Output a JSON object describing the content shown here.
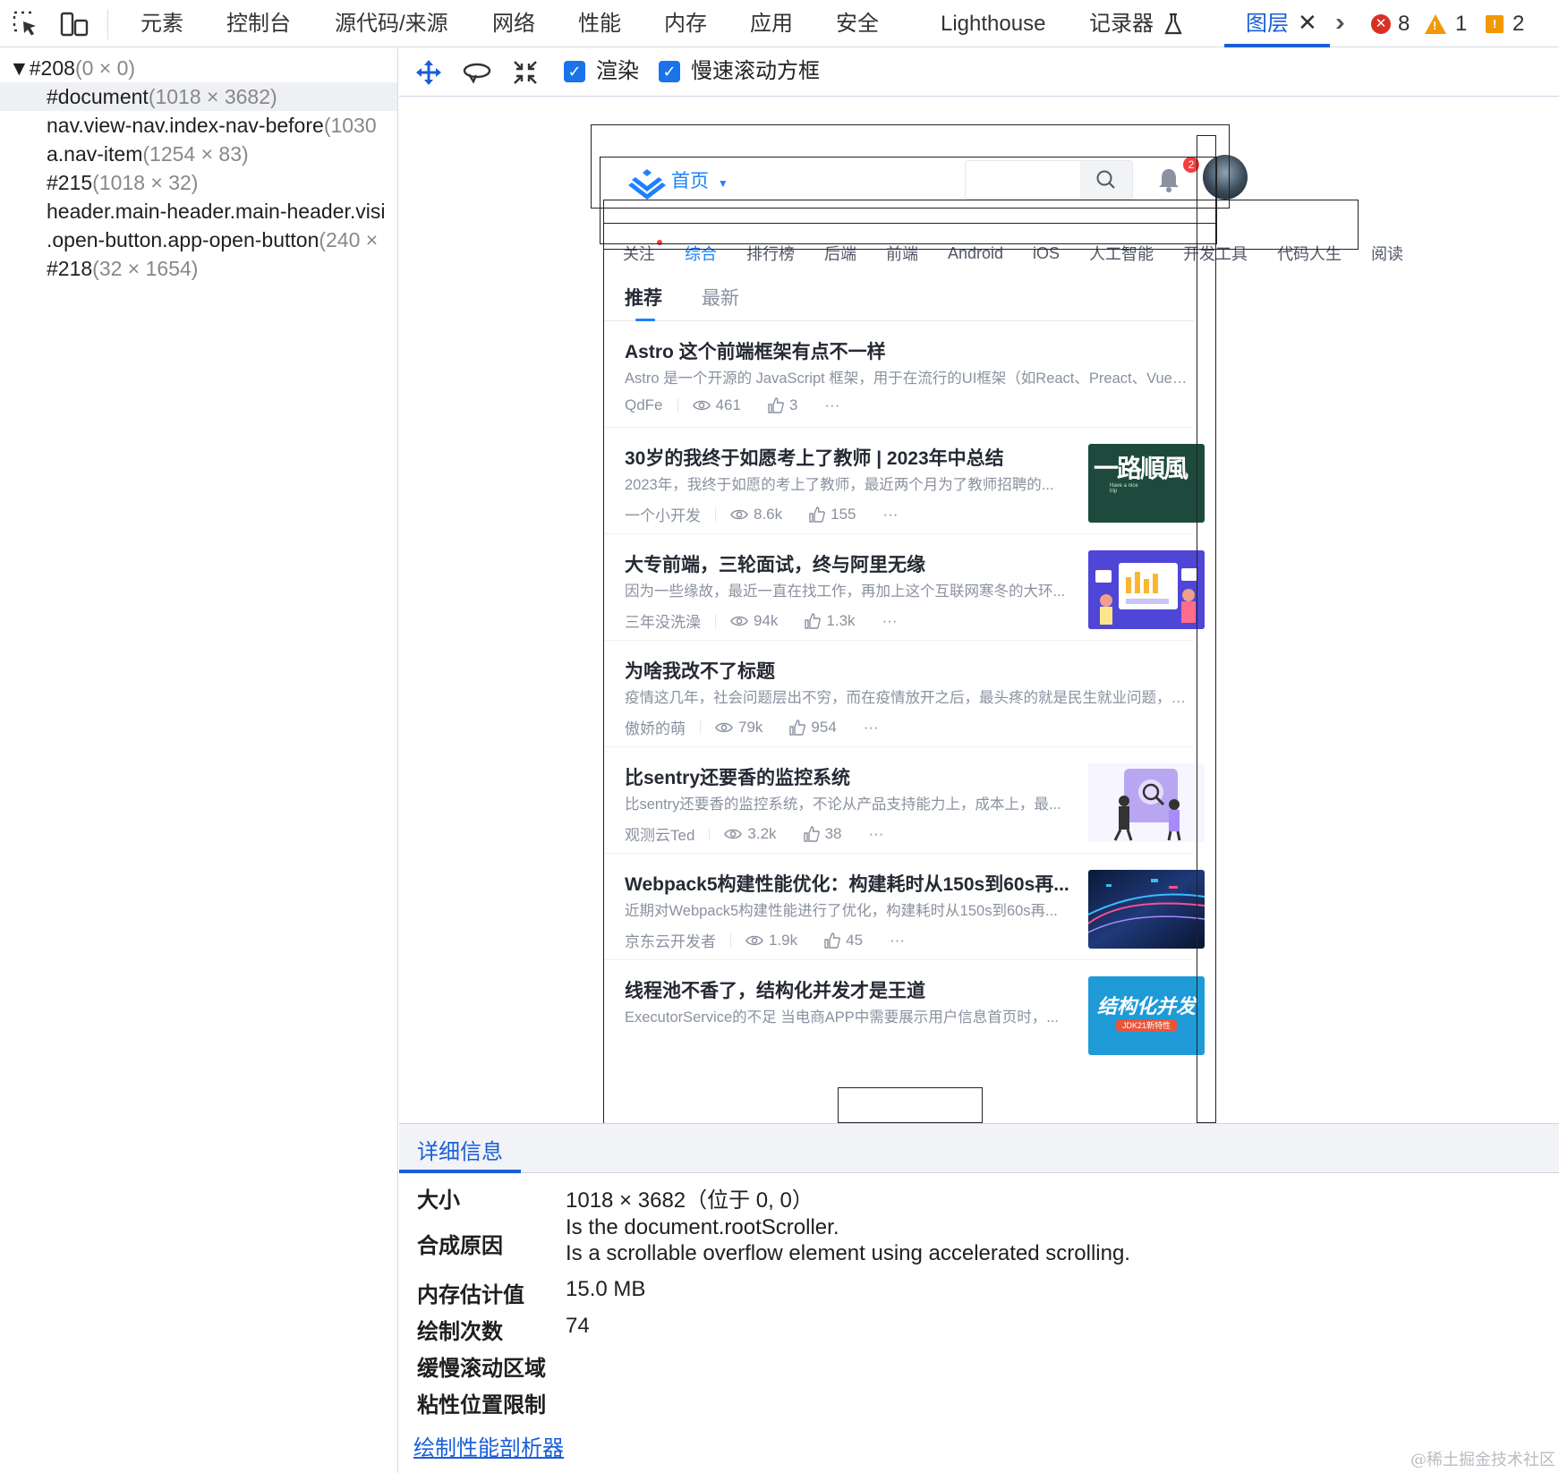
{
  "topbar": {
    "tabs": [
      "元素",
      "控制台",
      "源代码/来源",
      "网络",
      "性能",
      "内存",
      "应用",
      "安全",
      "Lighthouse",
      "记录器",
      "图层"
    ],
    "active_tab": "图层",
    "errors": "8",
    "warnings": "1",
    "issues": "2",
    "icons": [
      "inspect-element-icon",
      "device-toolbar-icon",
      "flask-icon",
      "close-icon",
      "more-tabs-icon"
    ]
  },
  "tree": {
    "items": [
      {
        "name": "▼#208",
        "dim": "(0 × 0)"
      },
      {
        "name": "#document",
        "dim": "(1018 × 3682)"
      },
      {
        "name": "nav.view-nav.index-nav-before",
        "dim": "(1030"
      },
      {
        "name": "a.nav-item",
        "dim": "(1254 × 83)"
      },
      {
        "name": "#215",
        "dim": "(1018 × 32)"
      },
      {
        "name": "header.main-header.main-header.visi",
        "dim": ""
      },
      {
        "name": ".open-button.app-open-button",
        "dim": "(240 ×"
      },
      {
        "name": "#218",
        "dim": "(32 × 1654)"
      }
    ]
  },
  "layer_toolbar": {
    "render_label": "渲染",
    "slow_scroll_label": "慢速滚动方框",
    "render_checked": true,
    "slow_scroll_checked": true
  },
  "preview": {
    "home_label": "首页",
    "bell_count": "2",
    "categories": [
      "关注",
      "综合",
      "排行榜",
      "后端",
      "前端",
      "Android",
      "iOS",
      "人工智能",
      "开发工具",
      "代码人生",
      "阅读"
    ],
    "active_category": "综合",
    "feed_tabs": [
      "推荐",
      "最新"
    ],
    "articles": [
      {
        "title": "Astro 这个前端框架有点不一样",
        "desc": "Astro 是一个开源的 JavaScript 框架，用于在流行的UI框架（如React、Preact、Vue 或...",
        "author": "QdFe",
        "views": "461",
        "likes": "3",
        "thumb": ""
      },
      {
        "title": "30岁的我终于如愿考上了教师 | 2023年中总结",
        "desc": "2023年，我终于如愿的考上了教师，最近两个月为了教师招聘的...",
        "author": "一个小开发",
        "views": "8.6k",
        "likes": "155",
        "thumb": "calligraphy"
      },
      {
        "title": "大专前端，三轮面试，终与阿里无缘",
        "desc": "因为一些缘故，最近一直在找工作，再加上这个互联网寒冬的大环...",
        "author": "三年没洗澡",
        "views": "94k",
        "likes": "1.3k",
        "thumb": "dashboard"
      },
      {
        "title": "为啥我改不了标题",
        "desc": "疫情这几年，社会问题层出不穷，而在疫情放开之后，最头疼的就是民生就业问题，大厂...",
        "author": "傲娇的萌",
        "views": "79k",
        "likes": "954",
        "thumb": ""
      },
      {
        "title": "比sentry还要香的监控系统",
        "desc": "比sentry还要香的监控系统，不论从产品支持能力上，成本上，最...",
        "author": "观测云Ted",
        "views": "3.2k",
        "likes": "38",
        "thumb": "monitor"
      },
      {
        "title": "Webpack5构建性能优化：构建耗时从150s到60s再...",
        "desc": "近期对Webpack5构建性能进行了优化，构建耗时从150s到60s再...",
        "author": "京东云开发者",
        "views": "1.9k",
        "likes": "45",
        "thumb": "tech"
      },
      {
        "title": "线程池不香了，结构化并发才是王道",
        "desc": "ExecutorService的不足 当电商APP中需要展示用户信息首页时，...",
        "author": "",
        "views": "",
        "likes": "",
        "thumb": "concurrency"
      }
    ],
    "thumb_texts": {
      "calligraphy_main": "一路順風",
      "calligraphy_small": "Have a nice trip",
      "concurrency_main": "结构化并发",
      "concurrency_sub": "JDK21新特性"
    }
  },
  "details": {
    "tab_label": "详细信息",
    "rows": [
      {
        "key": "大小",
        "value": "1018 × 3682（位于 0, 0）"
      },
      {
        "key": "合成原因",
        "value": "Is the document.rootScroller.",
        "value2": "Is a scrollable overflow element using accelerated scrolling."
      },
      {
        "key": "内存估计值",
        "value": "15.0 MB"
      },
      {
        "key": "绘制次数",
        "value": "74"
      },
      {
        "key": "缓慢滚动区域",
        "value": ""
      },
      {
        "key": "粘性位置限制",
        "value": ""
      }
    ],
    "paint_profiler_link": "绘制性能剖析器"
  },
  "watermark": "@稀土掘金技术社区",
  "colors": {
    "devtools_accent": "#1a5ed8",
    "juejin_blue": "#1e80ff",
    "error_red": "#d93025",
    "warning_orange": "#f29900"
  }
}
